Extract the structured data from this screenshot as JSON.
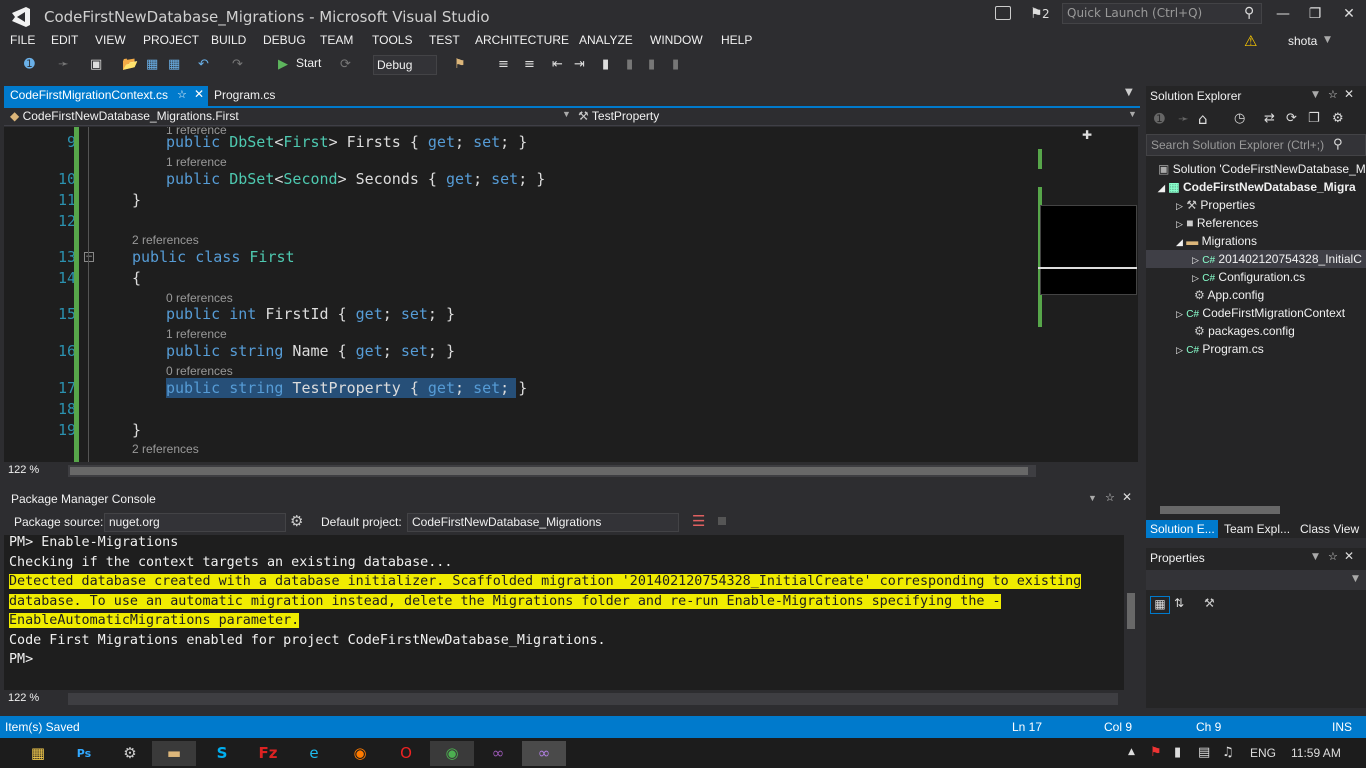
{
  "window": {
    "title": "CodeFirstNewDatabase_Migrations - Microsoft Visual Studio",
    "notification_count": "2",
    "quick_launch_placeholder": "Quick Launch (Ctrl+Q)",
    "user": "shota"
  },
  "menu": [
    "FILE",
    "EDIT",
    "VIEW",
    "PROJECT",
    "BUILD",
    "DEBUG",
    "TEAM",
    "TOOLS",
    "TEST",
    "ARCHITECTURE",
    "ANALYZE",
    "WINDOW",
    "HELP"
  ],
  "toolbar": {
    "start_label": "Start",
    "configuration": "Debug"
  },
  "editor": {
    "tabs": [
      {
        "label": "CodeFirstMigrationContext.cs",
        "active": true
      },
      {
        "label": "Program.cs",
        "active": false
      }
    ],
    "nav_left": "CodeFirstNewDatabase_Migrations.First",
    "nav_right": "TestProperty",
    "zoom": "122 %",
    "lines": [
      {
        "num": "9",
        "ref": "1 reference"
      },
      {
        "num": "10",
        "ref": "1 reference"
      },
      {
        "num": "11"
      },
      {
        "num": "12"
      },
      {
        "num": "13",
        "ref": "2 references"
      },
      {
        "num": "14"
      },
      {
        "num": "15",
        "ref": "0 references"
      },
      {
        "num": "16",
        "ref": "1 reference"
      },
      {
        "num": "17",
        "ref": "0 references"
      },
      {
        "num": "18"
      },
      {
        "num": "19"
      },
      {
        "ref": "2 references"
      }
    ],
    "code": {
      "l9": [
        "public ",
        "DbSet",
        "<",
        "First",
        "> Firsts { ",
        "get",
        "; ",
        "set",
        "; }"
      ],
      "l10": [
        "public ",
        "DbSet",
        "<",
        "Second",
        "> Seconds { ",
        "get",
        "; ",
        "set",
        "; }"
      ],
      "l11": "}",
      "l13": [
        "public ",
        "class ",
        "First"
      ],
      "l14": "{",
      "l15": [
        "public ",
        "int",
        " FirstId { ",
        "get",
        "; ",
        "set",
        "; }"
      ],
      "l16": [
        "public ",
        "string",
        " Name { ",
        "get",
        "; ",
        "set",
        "; }"
      ],
      "l17": [
        "public ",
        "string",
        " TestProperty { ",
        "get",
        "; ",
        "set",
        "; }"
      ],
      "l19": "}"
    }
  },
  "console": {
    "title": "Package Manager Console",
    "package_source_label": "Package source:",
    "package_source": "nuget.org",
    "default_project_label": "Default project:",
    "default_project": "CodeFirstNewDatabase_Migrations",
    "zoom": "122 %",
    "lines": [
      {
        "text": "PM> Enable-Migrations",
        "highlight": false
      },
      {
        "text": "Checking if the context targets an existing database...",
        "highlight": false
      },
      {
        "text": "Detected database created with a database initializer. Scaffolded migration '201402120754328_InitialCreate' corresponding to existing",
        "highlight": true
      },
      {
        "text": "database. To use an automatic migration instead, delete the Migrations folder and re-run Enable-Migrations specifying the -",
        "highlight": true
      },
      {
        "text": "EnableAutomaticMigrations parameter.",
        "highlight": true
      },
      {
        "text": "Code First Migrations enabled for project CodeFirstNewDatabase_Migrations.",
        "highlight": false
      },
      {
        "text": "PM>",
        "highlight": false
      }
    ]
  },
  "solution_explorer": {
    "title": "Solution Explorer",
    "search_placeholder": "Search Solution Explorer (Ctrl+;)",
    "items": [
      {
        "label": "Solution 'CodeFirstNewDatabase_M",
        "icon": "solution-icon"
      },
      {
        "label": "CodeFirstNewDatabase_Migra",
        "icon": "csharp-project-icon"
      },
      {
        "label": "Properties",
        "icon": "wrench-icon"
      },
      {
        "label": "References",
        "icon": "references-icon"
      },
      {
        "label": "Migrations",
        "icon": "folder-icon"
      },
      {
        "label": "201402120754328_InitialC",
        "icon": "csharp-file-icon"
      },
      {
        "label": "Configuration.cs",
        "icon": "csharp-file-icon"
      },
      {
        "label": "App.config",
        "icon": "config-icon"
      },
      {
        "label": "CodeFirstMigrationContext",
        "icon": "csharp-file-icon"
      },
      {
        "label": "packages.config",
        "icon": "config-icon"
      },
      {
        "label": "Program.cs",
        "icon": "csharp-file-icon"
      }
    ],
    "bottom_tabs": [
      "Solution E...",
      "Team Expl...",
      "Class View"
    ]
  },
  "properties": {
    "title": "Properties"
  },
  "status": {
    "message": "Item(s) Saved",
    "ln": "Ln 17",
    "col": "Col 9",
    "ch": "Ch 9",
    "mode": "INS"
  },
  "taskbar": {
    "language": "ENG",
    "time": "11:59 AM"
  },
  "colors": {
    "accent": "#007acc",
    "highlight": "#f0ec00",
    "keyword": "#569cd6",
    "type": "#4ec9b0"
  }
}
